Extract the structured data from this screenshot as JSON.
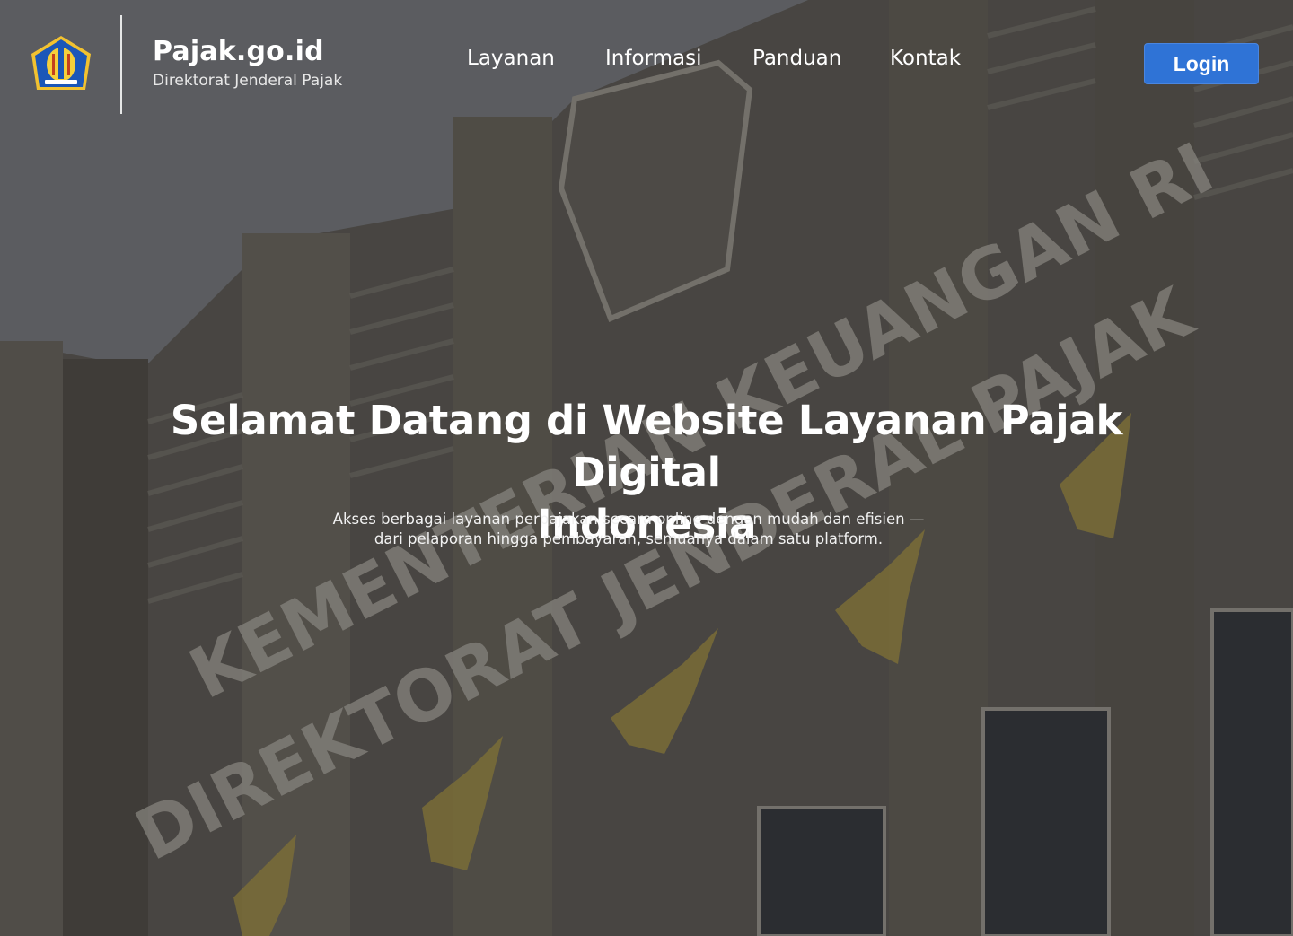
{
  "brand": {
    "title": "Pajak.go.id",
    "subtitle": "Direktorat Jenderal Pajak",
    "logo_icon": "ministry-of-finance-emblem-icon"
  },
  "nav": {
    "items": [
      {
        "label": "Layanan"
      },
      {
        "label": "Informasi"
      },
      {
        "label": "Panduan"
      },
      {
        "label": "Kontak"
      }
    ],
    "login_label": "Login"
  },
  "hero": {
    "title_line1": "Selamat Datang di Website Layanan Pajak Digital",
    "title_line2": "Indonesia",
    "description_line1": "Akses berbagai layanan perpajakan secara online dengan mudah dan efisien —",
    "description_line2": "dari pelaporan hingga pembayaran, semuanya dalam satu platform.",
    "background_image": "building-facade-photo",
    "building_sign_upper": "KEMENTERIAN KEUANGAN RI",
    "building_sign_lower": "DIREKTORAT JENDERAL PAJAK"
  },
  "colors": {
    "accent": "#2f73d6",
    "text": "#ffffff",
    "overlay": "#141416"
  }
}
